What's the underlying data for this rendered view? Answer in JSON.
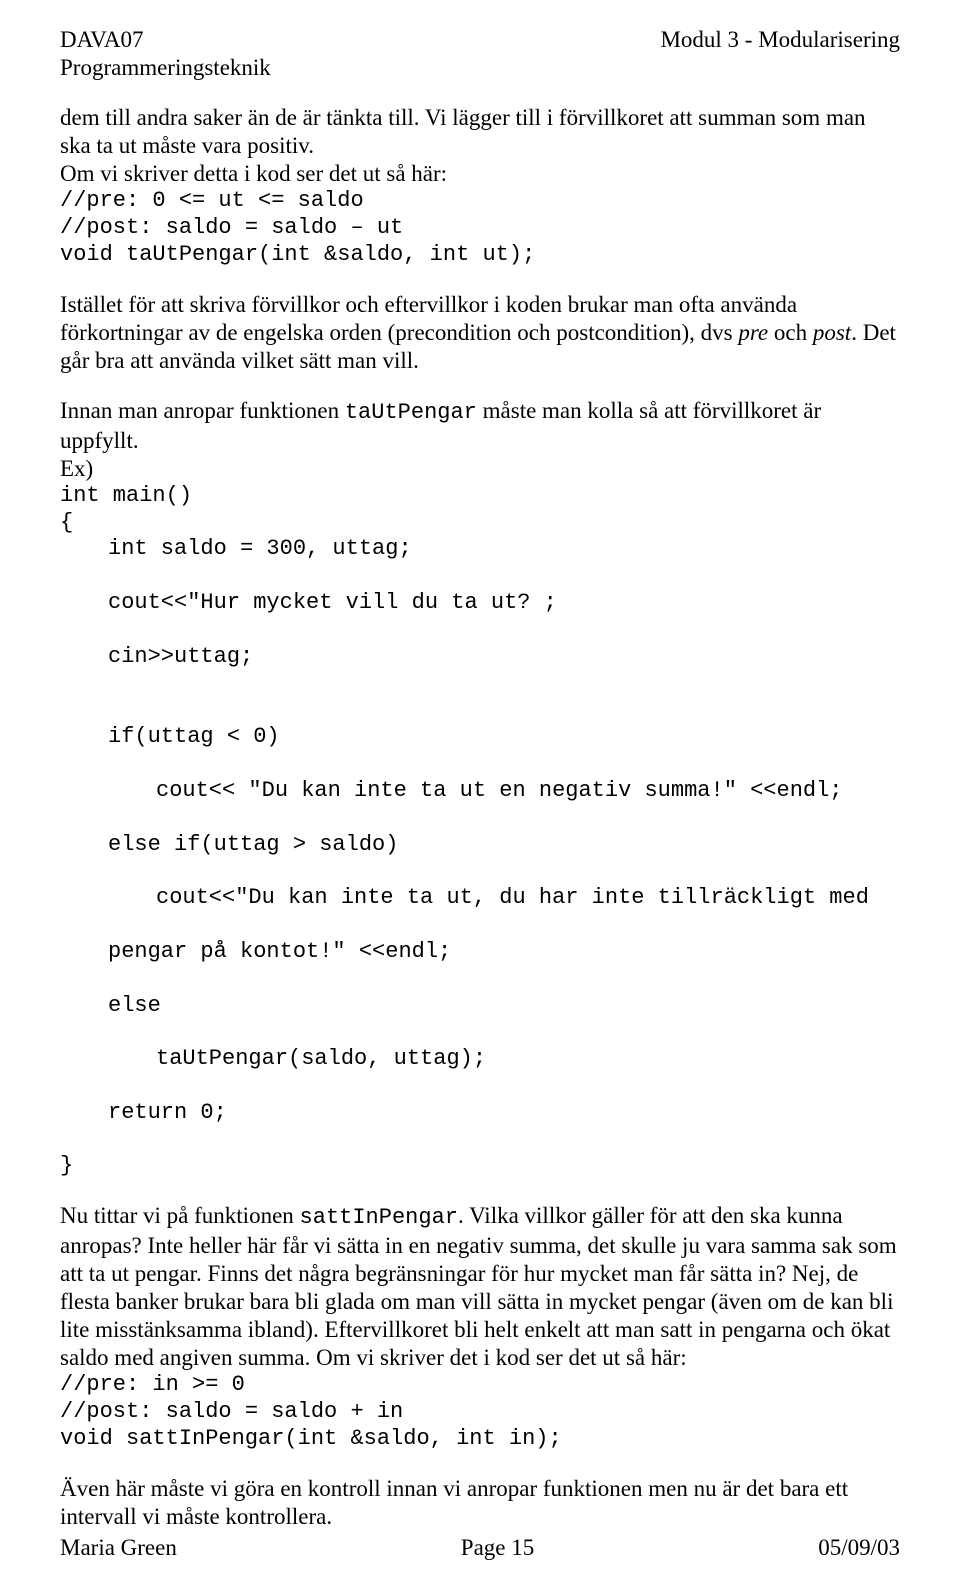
{
  "header": {
    "left1": "DAVA07",
    "left2": "Programmeringsteknik",
    "right1": "Modul 3 - Modularisering"
  },
  "content": {
    "p1": "dem till andra saker än de är tänkta till. Vi lägger till i förvillkoret att summan som man ska ta ut måste vara positiv.",
    "p2a": "Om vi skriver detta i kod ser det ut så här:",
    "code1_l1": "//pre: 0 <= ut <= saldo",
    "code1_l2": "//post: saldo = saldo – ut",
    "code1_l3": "void taUtPengar(int &saldo, int ut);",
    "p3a": "Istället för att skriva förvillkor och eftervillkor i koden brukar man ofta använda förkortningar av de engelska orden (precondition och postcondition), dvs ",
    "p3b": "pre",
    "p3c": " och ",
    "p3d": "post",
    "p3e": ". Det går bra att använda vilket sätt man vill.",
    "p4a": "Innan man anropar funktionen ",
    "p4b": "taUtPengar",
    "p4c": " måste man kolla så att förvillkoret är uppfyllt.",
    "p4d": "Ex)",
    "ex_l1": "int main()",
    "ex_l2": "{",
    "ex_l3": "int saldo = 300, uttag;",
    "ex_l4": "cout<<\"Hur mycket vill du ta ut? ;",
    "ex_l5": "cin>>uttag;",
    "ex_l6": "if(uttag < 0)",
    "ex_l7": "cout<< \"Du kan inte ta ut en negativ summa!\" <<endl;",
    "ex_l8": "else if(uttag > saldo)",
    "ex_l9": "cout<<\"Du kan inte ta ut, du har inte tillräckligt med",
    "ex_l10": "pengar på kontot!\" <<endl;",
    "ex_l11": "else",
    "ex_l12": "taUtPengar(saldo, uttag);",
    "ex_l13": "return 0;",
    "ex_l14": "}",
    "p5a": "Nu tittar vi på funktionen ",
    "p5b": "sattInPengar",
    "p5c": ". Vilka villkor gäller för att den ska kunna anropas? Inte heller här får vi sätta in en negativ summa, det skulle ju vara samma sak som att ta ut pengar. Finns det några begränsningar för hur mycket man får sätta in? Nej, de flesta banker brukar bara bli glada om man vill sätta in mycket pengar (även om de kan bli lite misstänksamma ibland). Eftervillkoret bli helt enkelt att man satt in pengarna och ökat saldo med angiven summa. Om vi skriver det i kod ser det ut så här:",
    "code3_l1": "//pre: in >= 0",
    "code3_l2": "//post: saldo = saldo + in",
    "code3_l3": "void sattInPengar(int &saldo, int in);",
    "p6": "Även här måste vi göra en kontroll innan vi anropar funktionen men nu är det bara ett intervall vi måste kontrollera."
  },
  "footer": {
    "left": "Maria Green",
    "center": "Page 15",
    "right": "05/09/03"
  }
}
